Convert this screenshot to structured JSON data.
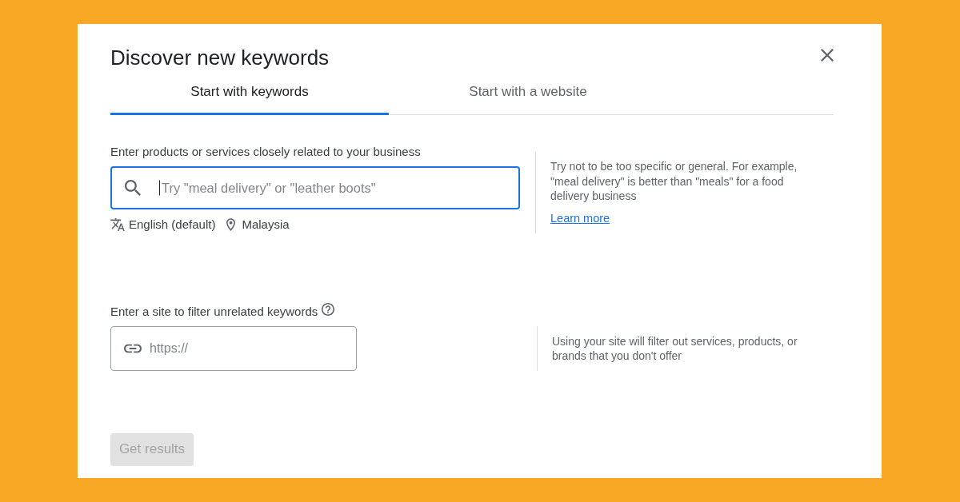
{
  "dialog": {
    "title": "Discover new keywords"
  },
  "tabs": [
    {
      "label": "Start with keywords",
      "selected": true
    },
    {
      "label": "Start with a website",
      "selected": false
    }
  ],
  "keywords_section": {
    "label": "Enter products or services closely related to your business",
    "search_field": {
      "placeholder": "Try \"meal delivery\" or \"leather boots\"",
      "focused": true
    },
    "language": "English (default)",
    "location": "Malaysia",
    "tip": "Try not to be too specific or general. For example, \"meal delivery\" is better than \"meals\" for a food delivery business",
    "tip_link": "Learn more"
  },
  "site_section": {
    "label": "Enter a site to filter unrelated keywords",
    "url_field": {
      "placeholder": "https://"
    },
    "tip": "Using your site will filter out services, products, or brands that you don't offer"
  },
  "submit_button": {
    "label": "Get results",
    "disabled": true
  }
}
